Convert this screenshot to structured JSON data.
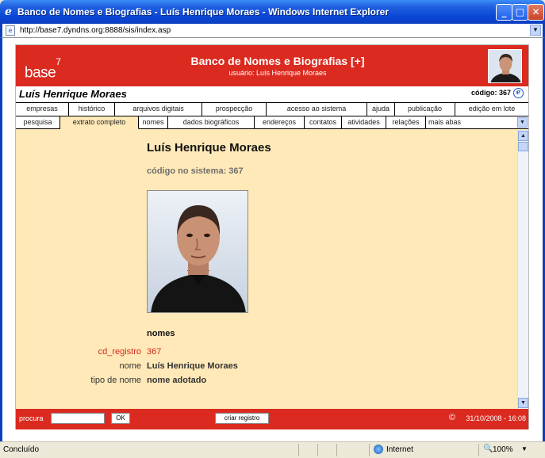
{
  "window": {
    "title": "Banco de Nomes e Biografias - Luís Henrique Moraes - Windows Internet Explorer",
    "minimize": "_",
    "maximize": "□",
    "close": "✕"
  },
  "address": {
    "url": "http://base7.dyndns.org:8888/sis/index.asp"
  },
  "header": {
    "logo": "base",
    "logo_sup": "7",
    "title": "Banco de Nomes e Biografias [+]",
    "subtitle": "usuário: Luís Henrique Moraes"
  },
  "record": {
    "person_name": "Luís Henrique Moraes",
    "code_label": "código: 367"
  },
  "tabs_row1": [
    "empresas",
    "histórico",
    "arquivos digitais",
    "prospecção",
    "acesso ao sistema",
    "ajuda",
    "publicação",
    "edição em lote"
  ],
  "tabs_row2": [
    "pesquisa",
    "extrato completo",
    "nomes",
    "dados biográficos",
    "endereços",
    "contatos",
    "atividades",
    "relações",
    "mais abas"
  ],
  "content": {
    "title": "Luís Henrique Moraes",
    "system_code": "código no sistema: 367",
    "section_title": "nomes",
    "fields": [
      {
        "label": "cd_registro",
        "value": "367"
      },
      {
        "label": "nome",
        "value": "Luís Henrique Moraes"
      },
      {
        "label": "tipo de nome",
        "value": "nome adotado"
      }
    ]
  },
  "footer": {
    "search_label": "procura",
    "search_value": "",
    "ok_label": "OK",
    "create_label": "criar registro",
    "copyright": "©",
    "datetime": "31/10/2008 - 16:08"
  },
  "statusbar": {
    "status": "Concluído",
    "zone": "Internet",
    "zoom": "100%"
  },
  "colors": {
    "brand_red": "#DB2A1F",
    "content_bg": "#FFE9B8"
  }
}
